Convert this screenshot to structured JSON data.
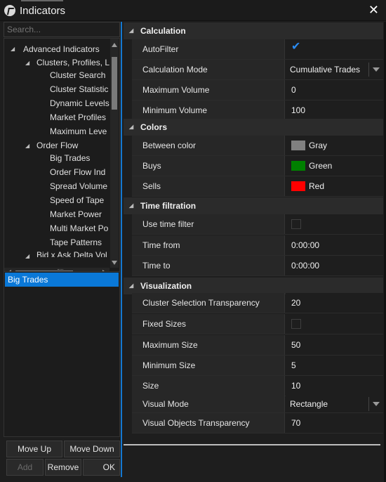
{
  "window": {
    "title": "Indicators",
    "close_label": "✕"
  },
  "search": {
    "placeholder": "Search..."
  },
  "tree": {
    "items": [
      {
        "label": "Advanced Indicators",
        "expanded": true
      },
      {
        "label": "Clusters, Profiles, L",
        "expanded": true
      },
      {
        "label": "Cluster Search"
      },
      {
        "label": "Cluster Statistic"
      },
      {
        "label": "Dynamic Levels"
      },
      {
        "label": "Market Profiles"
      },
      {
        "label": "Maximum Leve"
      },
      {
        "label": "Order Flow",
        "expanded": true
      },
      {
        "label": "Big Trades"
      },
      {
        "label": "Order Flow Ind"
      },
      {
        "label": "Spread Volume"
      },
      {
        "label": "Speed of Tape"
      },
      {
        "label": "Market Power"
      },
      {
        "label": "Multi Market Po"
      },
      {
        "label": "Tape Patterns"
      },
      {
        "label": "Bid x Ask Delta Vol"
      }
    ]
  },
  "selected": {
    "items": [
      "Big Trades"
    ]
  },
  "buttons": {
    "move_up": "Move Up",
    "move_down": "Move Down",
    "add": "Add",
    "remove": "Remove",
    "ok": "OK"
  },
  "categories": {
    "calculation": {
      "title": "Calculation",
      "autofilter": {
        "name": "AutoFilter",
        "checked": true
      },
      "calc_mode": {
        "name": "Calculation Mode",
        "value": "Cumulative Trades"
      },
      "max_volume": {
        "name": "Maximum Volume",
        "value": "0"
      },
      "min_volume": {
        "name": "Minimum Volume",
        "value": "100"
      }
    },
    "colors": {
      "title": "Colors",
      "between": {
        "name": "Between color",
        "value": "Gray",
        "color": "#808080"
      },
      "buys": {
        "name": "Buys",
        "value": "Green",
        "color": "#008000"
      },
      "sells": {
        "name": "Sells",
        "value": "Red",
        "color": "#ff0000"
      }
    },
    "time": {
      "title": "Time filtration",
      "use_filter": {
        "name": "Use time filter",
        "checked": false
      },
      "from": {
        "name": "Time from",
        "value": "0:00:00"
      },
      "to": {
        "name": "Time to",
        "value": "0:00:00"
      }
    },
    "visualization": {
      "title": "Visualization",
      "cluster_transp": {
        "name": "Cluster Selection Transparency",
        "value": "20"
      },
      "fixed_sizes": {
        "name": "Fixed Sizes",
        "checked": false
      },
      "max_size": {
        "name": "Maximum Size",
        "value": "50"
      },
      "min_size": {
        "name": "Minimum Size",
        "value": "5"
      },
      "size": {
        "name": "Size",
        "value": "10"
      },
      "visual_mode": {
        "name": "Visual Mode",
        "value": "Rectangle"
      },
      "objects_transp": {
        "name": "Visual Objects Transparency",
        "value": "70"
      }
    }
  }
}
